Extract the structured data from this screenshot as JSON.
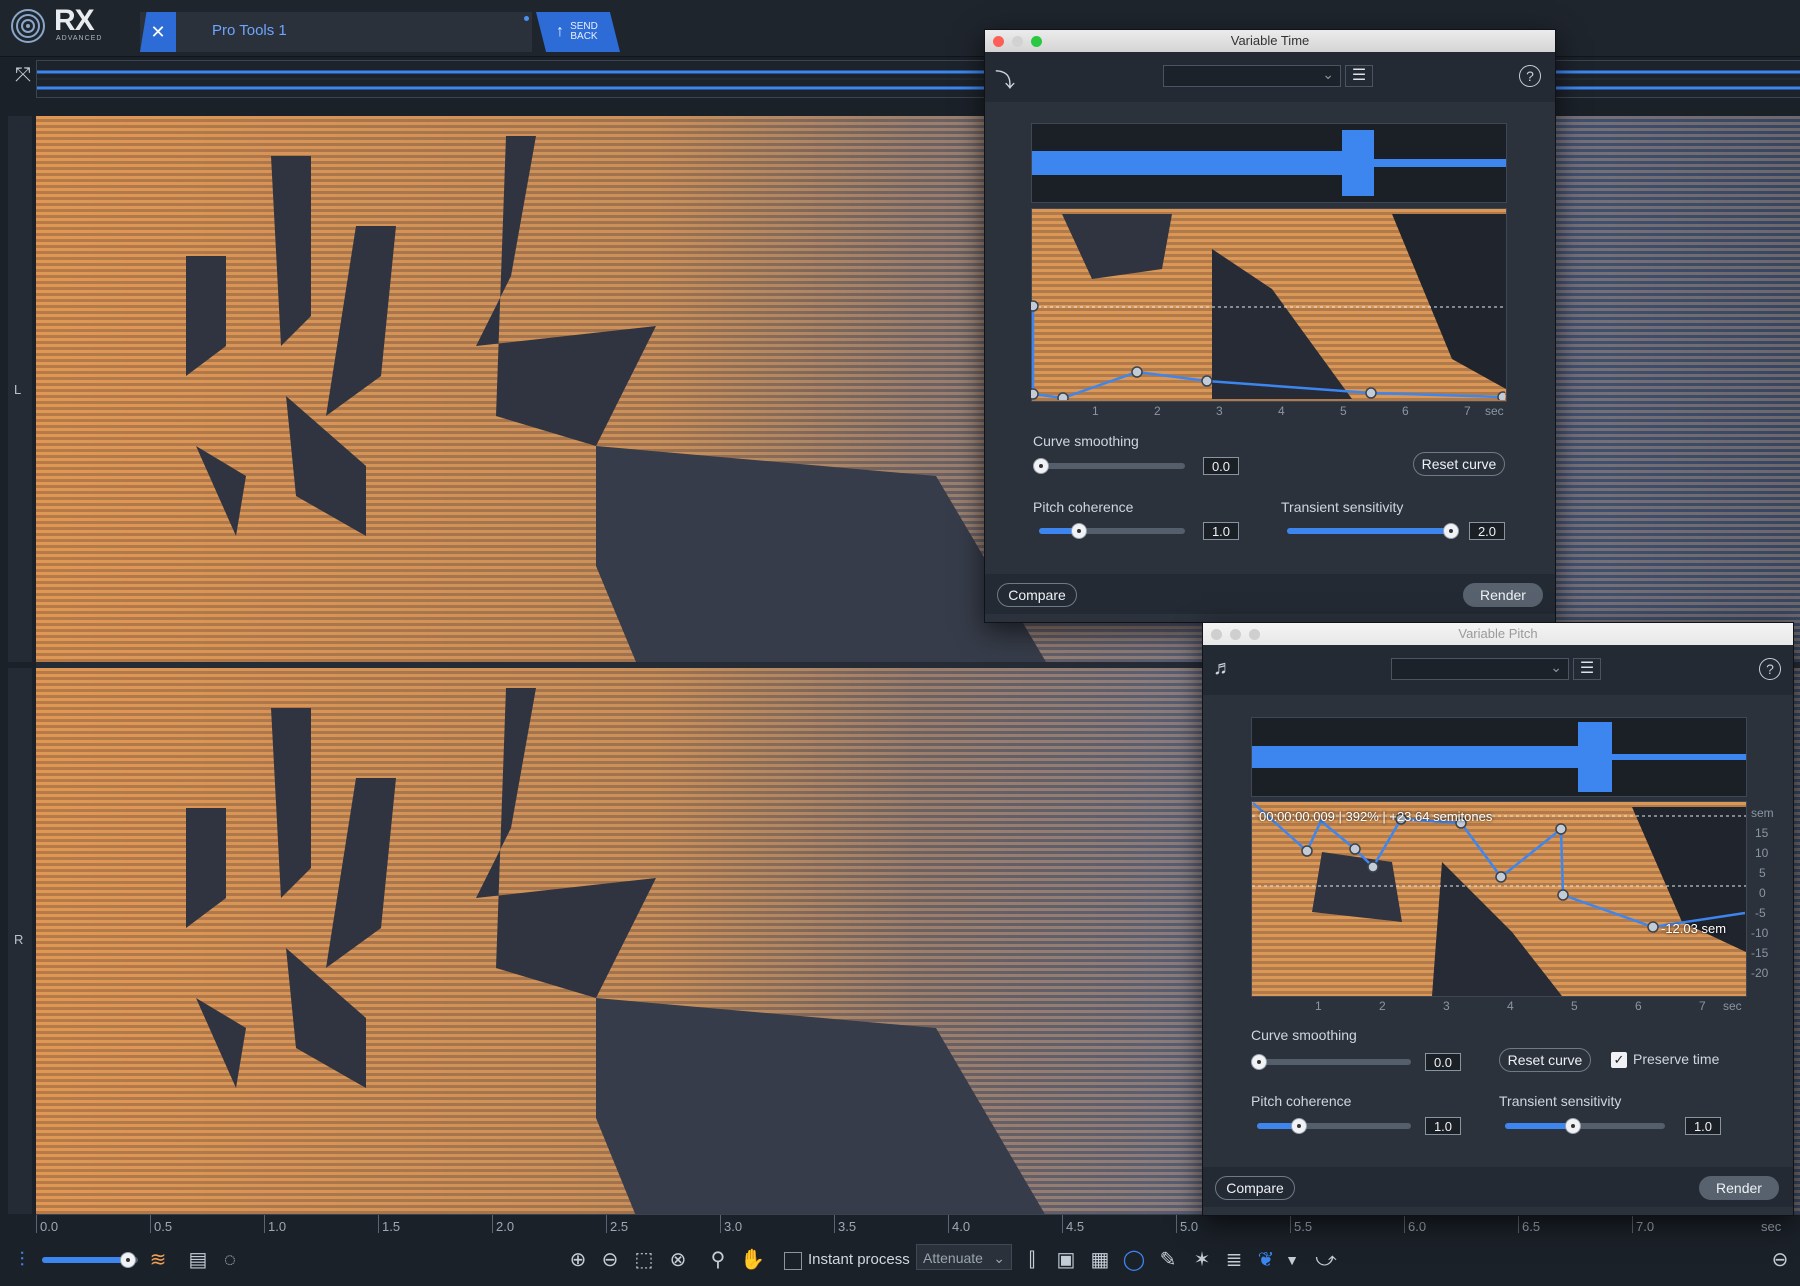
{
  "app": {
    "logo": "RX",
    "logo_sub": "ADVANCED",
    "host_tab": "Pro Tools 1",
    "send_back": "SEND BACK"
  },
  "channels": [
    "L",
    "R"
  ],
  "ruler": [
    "0.0",
    "0.5",
    "1.0",
    "1.5",
    "2.0",
    "2.5",
    "3.0",
    "3.5",
    "4.0",
    "4.5",
    "5.0",
    "5.5",
    "6.0",
    "6.5",
    "7.0",
    "sec"
  ],
  "toolbar": {
    "instant_process": "Instant process",
    "mode": "Attenuate"
  },
  "variable_time": {
    "title": "Variable Time",
    "axis": [
      "1",
      "2",
      "3",
      "4",
      "5",
      "6",
      "7",
      "sec"
    ],
    "curve_smoothing_label": "Curve smoothing",
    "curve_smoothing_value": "0.0",
    "curve_smoothing_level": 0.0,
    "reset_curve": "Reset curve",
    "pitch_coherence_label": "Pitch coherence",
    "pitch_coherence_value": "1.0",
    "pitch_coherence_level": 0.25,
    "transient_sensitivity_label": "Transient sensitivity",
    "transient_sensitivity_value": "2.0",
    "transient_sensitivity_level": 1.0,
    "compare": "Compare",
    "render": "Render"
  },
  "variable_pitch": {
    "title": "Variable Pitch",
    "axis": [
      "1",
      "2",
      "3",
      "4",
      "5",
      "6",
      "7",
      "sec"
    ],
    "sem_axis": [
      "sem",
      "15",
      "10",
      "5",
      "0",
      "-5",
      "-10",
      "-15",
      "-20"
    ],
    "readout": "00:00:00.009 | 392% | +23.64 semitones",
    "point_label": "-12.03 sem",
    "curve_smoothing_label": "Curve smoothing",
    "curve_smoothing_value": "0.0",
    "curve_smoothing_level": 0.0,
    "reset_curve": "Reset curve",
    "preserve_time": "Preserve time",
    "preserve_time_checked": true,
    "pitch_coherence_label": "Pitch coherence",
    "pitch_coherence_value": "1.0",
    "pitch_coherence_level": 0.25,
    "transient_sensitivity_label": "Transient sensitivity",
    "transient_sensitivity_value": "1.0",
    "transient_sensitivity_level": 0.42,
    "compare": "Compare",
    "render": "Render"
  },
  "colors": {
    "accent": "#3d86f0",
    "spectrum_hot": "#f0a055",
    "spectrum_cool": "#4c5f86"
  }
}
